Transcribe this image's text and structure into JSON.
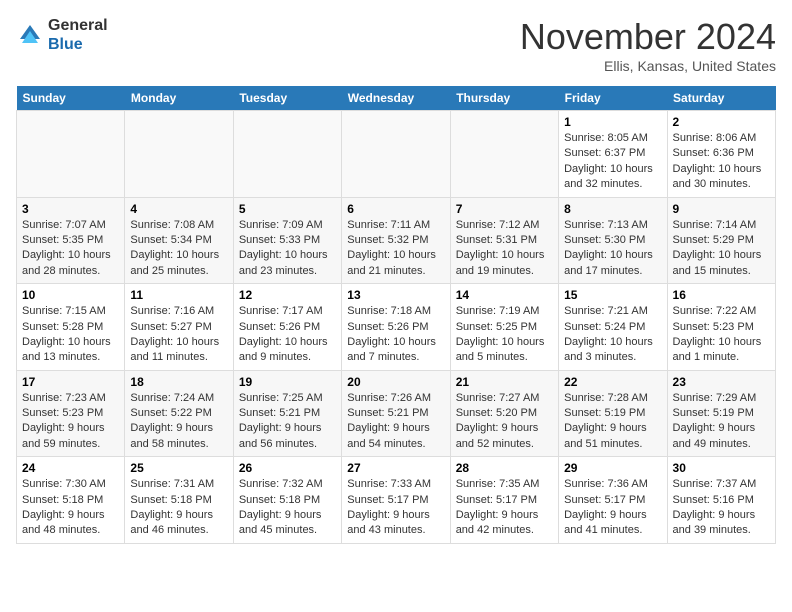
{
  "header": {
    "logo_general": "General",
    "logo_blue": "Blue",
    "month_title": "November 2024",
    "location": "Ellis, Kansas, United States"
  },
  "days_of_week": [
    "Sunday",
    "Monday",
    "Tuesday",
    "Wednesday",
    "Thursday",
    "Friday",
    "Saturday"
  ],
  "weeks": [
    {
      "cells": [
        {
          "day": null,
          "empty": true
        },
        {
          "day": null,
          "empty": true
        },
        {
          "day": null,
          "empty": true
        },
        {
          "day": null,
          "empty": true
        },
        {
          "day": null,
          "empty": true
        },
        {
          "day": "1",
          "sunrise": "Sunrise: 8:05 AM",
          "sunset": "Sunset: 6:37 PM",
          "daylight": "Daylight: 10 hours and 32 minutes."
        },
        {
          "day": "2",
          "sunrise": "Sunrise: 8:06 AM",
          "sunset": "Sunset: 6:36 PM",
          "daylight": "Daylight: 10 hours and 30 minutes."
        }
      ]
    },
    {
      "cells": [
        {
          "day": "3",
          "sunrise": "Sunrise: 7:07 AM",
          "sunset": "Sunset: 5:35 PM",
          "daylight": "Daylight: 10 hours and 28 minutes."
        },
        {
          "day": "4",
          "sunrise": "Sunrise: 7:08 AM",
          "sunset": "Sunset: 5:34 PM",
          "daylight": "Daylight: 10 hours and 25 minutes."
        },
        {
          "day": "5",
          "sunrise": "Sunrise: 7:09 AM",
          "sunset": "Sunset: 5:33 PM",
          "daylight": "Daylight: 10 hours and 23 minutes."
        },
        {
          "day": "6",
          "sunrise": "Sunrise: 7:11 AM",
          "sunset": "Sunset: 5:32 PM",
          "daylight": "Daylight: 10 hours and 21 minutes."
        },
        {
          "day": "7",
          "sunrise": "Sunrise: 7:12 AM",
          "sunset": "Sunset: 5:31 PM",
          "daylight": "Daylight: 10 hours and 19 minutes."
        },
        {
          "day": "8",
          "sunrise": "Sunrise: 7:13 AM",
          "sunset": "Sunset: 5:30 PM",
          "daylight": "Daylight: 10 hours and 17 minutes."
        },
        {
          "day": "9",
          "sunrise": "Sunrise: 7:14 AM",
          "sunset": "Sunset: 5:29 PM",
          "daylight": "Daylight: 10 hours and 15 minutes."
        }
      ]
    },
    {
      "cells": [
        {
          "day": "10",
          "sunrise": "Sunrise: 7:15 AM",
          "sunset": "Sunset: 5:28 PM",
          "daylight": "Daylight: 10 hours and 13 minutes."
        },
        {
          "day": "11",
          "sunrise": "Sunrise: 7:16 AM",
          "sunset": "Sunset: 5:27 PM",
          "daylight": "Daylight: 10 hours and 11 minutes."
        },
        {
          "day": "12",
          "sunrise": "Sunrise: 7:17 AM",
          "sunset": "Sunset: 5:26 PM",
          "daylight": "Daylight: 10 hours and 9 minutes."
        },
        {
          "day": "13",
          "sunrise": "Sunrise: 7:18 AM",
          "sunset": "Sunset: 5:26 PM",
          "daylight": "Daylight: 10 hours and 7 minutes."
        },
        {
          "day": "14",
          "sunrise": "Sunrise: 7:19 AM",
          "sunset": "Sunset: 5:25 PM",
          "daylight": "Daylight: 10 hours and 5 minutes."
        },
        {
          "day": "15",
          "sunrise": "Sunrise: 7:21 AM",
          "sunset": "Sunset: 5:24 PM",
          "daylight": "Daylight: 10 hours and 3 minutes."
        },
        {
          "day": "16",
          "sunrise": "Sunrise: 7:22 AM",
          "sunset": "Sunset: 5:23 PM",
          "daylight": "Daylight: 10 hours and 1 minute."
        }
      ]
    },
    {
      "cells": [
        {
          "day": "17",
          "sunrise": "Sunrise: 7:23 AM",
          "sunset": "Sunset: 5:23 PM",
          "daylight": "Daylight: 9 hours and 59 minutes."
        },
        {
          "day": "18",
          "sunrise": "Sunrise: 7:24 AM",
          "sunset": "Sunset: 5:22 PM",
          "daylight": "Daylight: 9 hours and 58 minutes."
        },
        {
          "day": "19",
          "sunrise": "Sunrise: 7:25 AM",
          "sunset": "Sunset: 5:21 PM",
          "daylight": "Daylight: 9 hours and 56 minutes."
        },
        {
          "day": "20",
          "sunrise": "Sunrise: 7:26 AM",
          "sunset": "Sunset: 5:21 PM",
          "daylight": "Daylight: 9 hours and 54 minutes."
        },
        {
          "day": "21",
          "sunrise": "Sunrise: 7:27 AM",
          "sunset": "Sunset: 5:20 PM",
          "daylight": "Daylight: 9 hours and 52 minutes."
        },
        {
          "day": "22",
          "sunrise": "Sunrise: 7:28 AM",
          "sunset": "Sunset: 5:19 PM",
          "daylight": "Daylight: 9 hours and 51 minutes."
        },
        {
          "day": "23",
          "sunrise": "Sunrise: 7:29 AM",
          "sunset": "Sunset: 5:19 PM",
          "daylight": "Daylight: 9 hours and 49 minutes."
        }
      ]
    },
    {
      "cells": [
        {
          "day": "24",
          "sunrise": "Sunrise: 7:30 AM",
          "sunset": "Sunset: 5:18 PM",
          "daylight": "Daylight: 9 hours and 48 minutes."
        },
        {
          "day": "25",
          "sunrise": "Sunrise: 7:31 AM",
          "sunset": "Sunset: 5:18 PM",
          "daylight": "Daylight: 9 hours and 46 minutes."
        },
        {
          "day": "26",
          "sunrise": "Sunrise: 7:32 AM",
          "sunset": "Sunset: 5:18 PM",
          "daylight": "Daylight: 9 hours and 45 minutes."
        },
        {
          "day": "27",
          "sunrise": "Sunrise: 7:33 AM",
          "sunset": "Sunset: 5:17 PM",
          "daylight": "Daylight: 9 hours and 43 minutes."
        },
        {
          "day": "28",
          "sunrise": "Sunrise: 7:35 AM",
          "sunset": "Sunset: 5:17 PM",
          "daylight": "Daylight: 9 hours and 42 minutes."
        },
        {
          "day": "29",
          "sunrise": "Sunrise: 7:36 AM",
          "sunset": "Sunset: 5:17 PM",
          "daylight": "Daylight: 9 hours and 41 minutes."
        },
        {
          "day": "30",
          "sunrise": "Sunrise: 7:37 AM",
          "sunset": "Sunset: 5:16 PM",
          "daylight": "Daylight: 9 hours and 39 minutes."
        }
      ]
    }
  ]
}
